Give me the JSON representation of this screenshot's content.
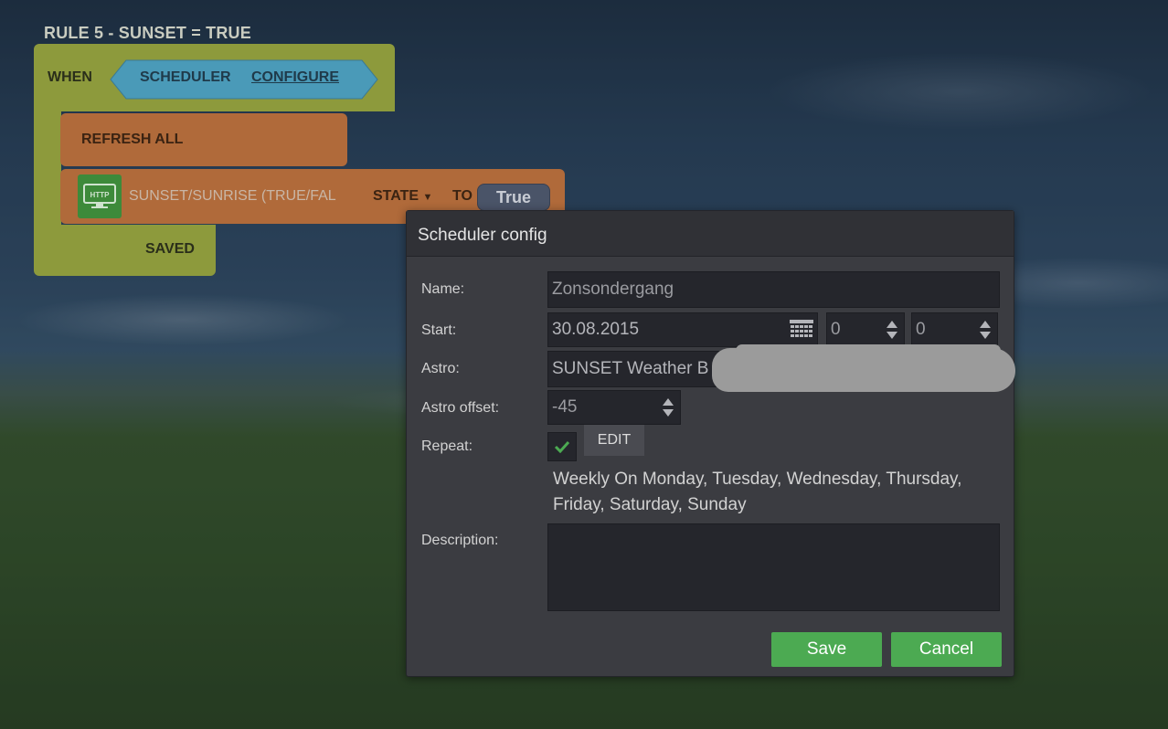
{
  "rule": {
    "title": "RULE 5 - SUNSET = TRUE",
    "when_label": "WHEN",
    "scheduler_label": "SCHEDULER",
    "configure_link": "CONFIGURE",
    "refresh_label": "REFRESH ALL",
    "http_icon_text": "HTTP",
    "http_label": "SUNSET/SUNRISE (TRUE/FAL",
    "state_dropdown": "STATE",
    "to_label": "TO",
    "value_label": "True",
    "saved_label": "SAVED"
  },
  "dialog": {
    "title": "Scheduler config",
    "name_label": "Name:",
    "name_value": "Zonsondergang",
    "start_label": "Start:",
    "start_date": "30.08.2015",
    "start_hour": "0",
    "start_minute": "0",
    "astro_label": "Astro:",
    "astro_value": "SUNSET Weather B",
    "astro_offset_label": "Astro offset:",
    "astro_offset_value": "-45",
    "repeat_label": "Repeat:",
    "repeat_checked": true,
    "edit_label": "EDIT",
    "repeat_summary": "Weekly On Monday, Tuesday, Wednesday, Thursday, Friday, Saturday, Sunday",
    "description_label": "Description:",
    "description_value": "",
    "save_label": "Save",
    "cancel_label": "Cancel"
  },
  "colors": {
    "accent_green": "#4caa52",
    "block_olive": "#8d9a3c",
    "block_orange": "#b06a3a",
    "block_blue": "#4a9ab8"
  }
}
